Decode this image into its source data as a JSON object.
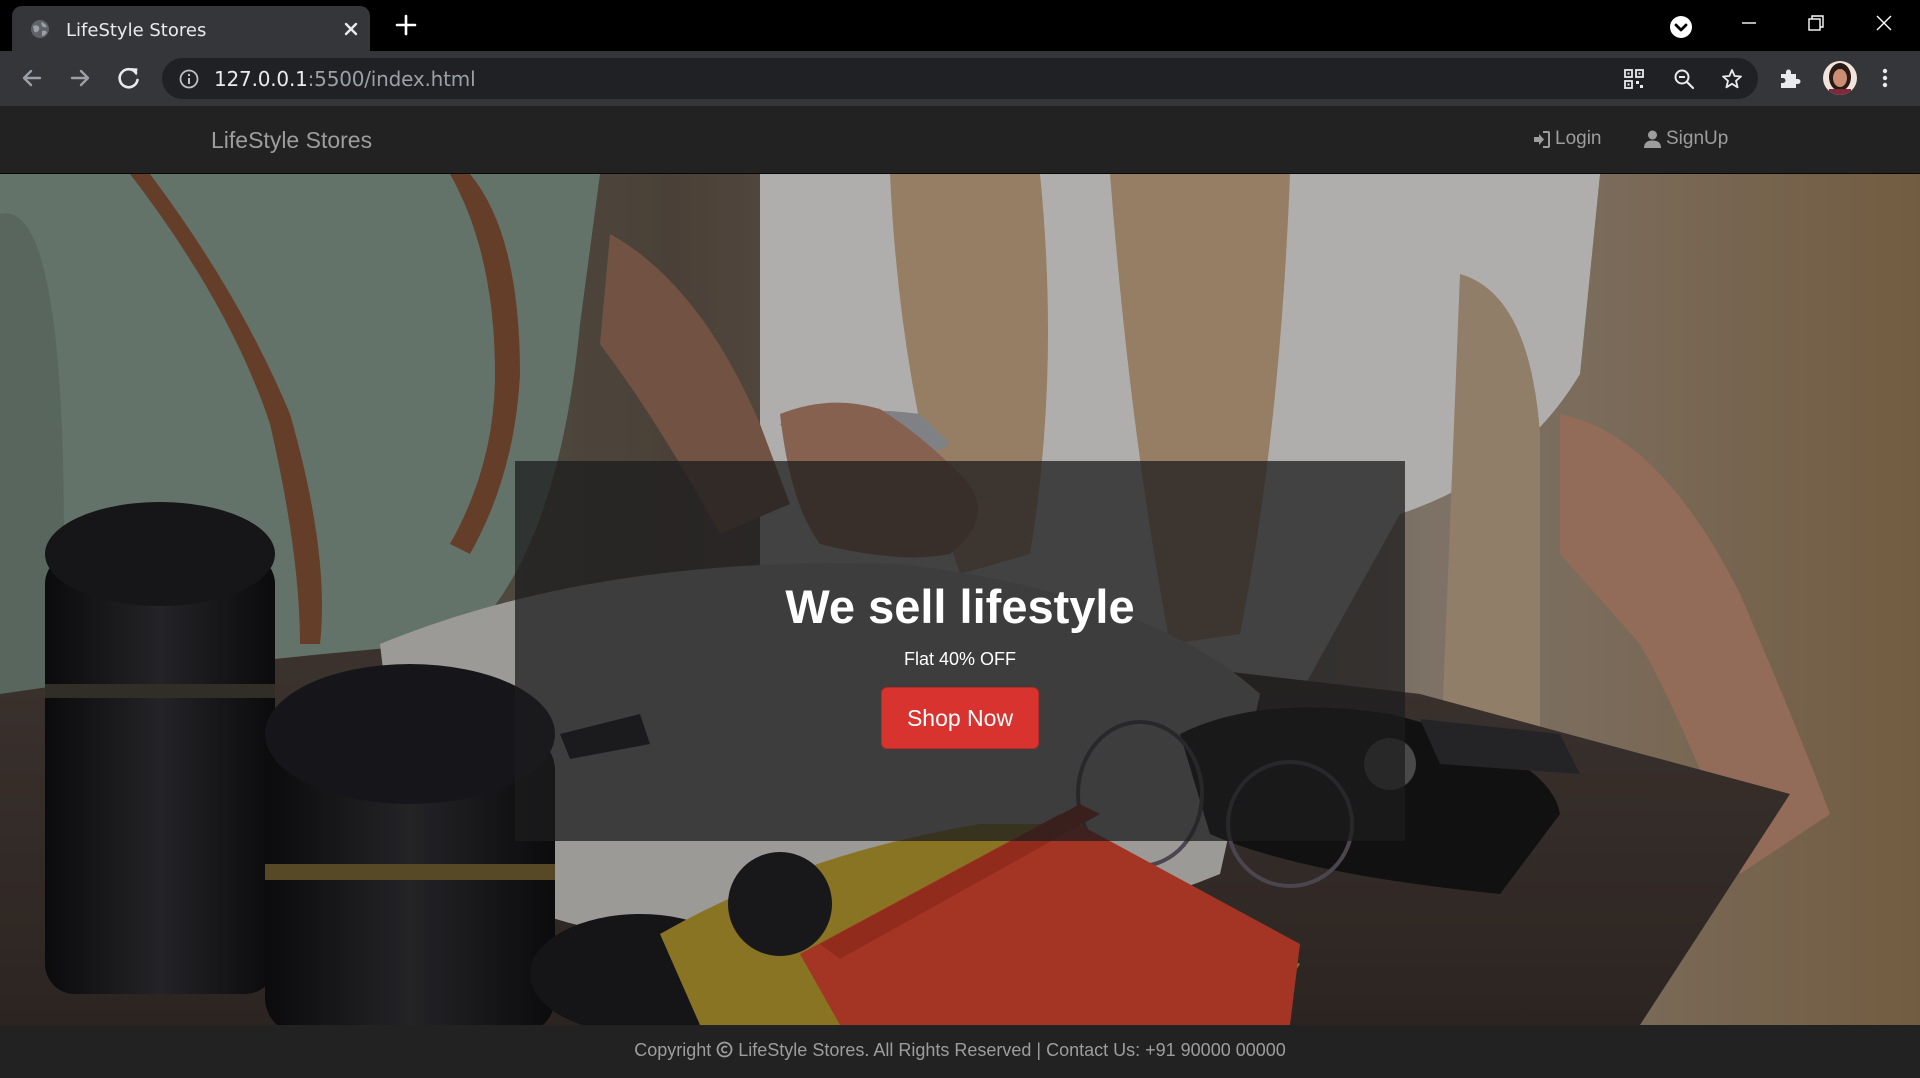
{
  "browser": {
    "tab_title": "LifeStyle Stores",
    "url_host": "127.0.0.1",
    "url_rest": ":5500/index.html",
    "icons": {
      "back": "arrow-left-icon",
      "forward": "arrow-right-icon",
      "reload": "reload-icon",
      "info": "info-icon",
      "qr": "qr-code-icon",
      "zoom": "zoom-out-icon",
      "bookmark": "star-icon",
      "extensions": "puzzle-icon",
      "menu": "kebab-menu-icon"
    }
  },
  "navbar": {
    "brand": "LifeStyle Stores",
    "login": "Login",
    "signup": "SignUp"
  },
  "banner": {
    "title": "We sell lifestyle",
    "subtitle": "Flat 40% OFF",
    "button": "Shop Now"
  },
  "footer": {
    "copyright_prefix": "Copyright",
    "copyright_suffix": "LifeStyle Stores. All Rights Reserved | Contact Us: +91 90000 00000"
  },
  "colors": {
    "navbar_bg": "#222222",
    "nav_text": "#9d9d9d",
    "button_red": "#d9332f",
    "chrome_tabstrip": "#000000",
    "chrome_toolbar": "#35363a"
  }
}
